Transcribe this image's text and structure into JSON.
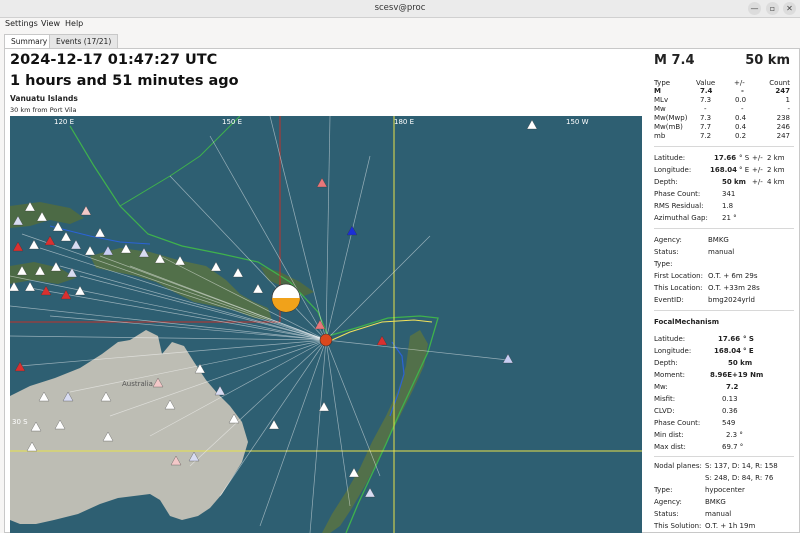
{
  "window": {
    "title": "scesv@proc",
    "controls": {
      "minimize": "—",
      "maximize": "▫",
      "close": "✕"
    }
  },
  "menu": [
    "Settings",
    "View",
    "Help"
  ],
  "tabs": [
    {
      "label": "Summary",
      "active": true
    },
    {
      "label": "Events (17/21)",
      "active": false
    }
  ],
  "header": {
    "datetime": "2024-12-17 01:47:27 UTC",
    "ago": "1 hours and 51 minutes ago",
    "region": "Vanuatu Islands",
    "nearby": "30 km from Port Vila"
  },
  "map": {
    "lon_labels": [
      "120 E",
      "150 E",
      "180 E",
      "150 W"
    ],
    "lat_labels": [
      "30 S"
    ],
    "place_labels": [
      "Australia"
    ],
    "colors": {
      "ocean": "#2e5f72",
      "land": "#b9b9b1",
      "grid": "#e8e24a",
      "region_box": "#c0302a",
      "ray": "#ffffff",
      "epicenter": "#d9481e"
    }
  },
  "summary": {
    "magnitude": "M 7.4",
    "depth": "50 km",
    "mag_table": {
      "headers": [
        "Type",
        "Value",
        "+/-",
        "Count"
      ],
      "rows": [
        [
          "M",
          "7.4",
          "-",
          "247"
        ],
        [
          "MLv",
          "7.3",
          "0.0",
          "1"
        ],
        [
          "Mw",
          "-",
          "-",
          "-"
        ],
        [
          "Mw(Mwp)",
          "7.3",
          "0.4",
          "238"
        ],
        [
          "Mw(mB)",
          "7.7",
          "0.4",
          "246"
        ],
        [
          "mb",
          "7.2",
          "0.2",
          "247"
        ]
      ]
    },
    "location": {
      "latitude_label": "Latitude:",
      "latitude": "17.66",
      "lat_unit": "° S",
      "lat_pm": "+/-",
      "lat_unc": "2 km",
      "longitude_label": "Longitude:",
      "longitude": "168.04",
      "lon_unit": "° E",
      "lon_pm": "+/-",
      "lon_unc": "2 km",
      "depth_label": "Depth:",
      "depth": "50",
      "depth_unit": "km",
      "depth_pm": "+/-",
      "depth_unc": "4 km",
      "phase_label": "Phase Count:",
      "phase_count": "341",
      "rms_label": "RMS Residual:",
      "rms": "1.8",
      "gap_label": "Azimuthal Gap:",
      "gap": "21 °"
    },
    "origin_info": {
      "agency_label": "Agency:",
      "agency": "BMKG",
      "status_label": "Status:",
      "status": "manual",
      "type_label": "Type:",
      "type": "",
      "first_label": "First Location:",
      "first_location": "O.T. + 6m 29s",
      "this_label": "This Location:",
      "this_location": "O.T. +33m 28s",
      "eventid_label": "EventID:",
      "event_id": "bmg2024yrld"
    },
    "focal": {
      "title": "FocalMechanism",
      "latitude_label": "Latitude:",
      "latitude": "17.66",
      "lat_unit": "° S",
      "longitude_label": "Longitude:",
      "longitude": "168.04",
      "lon_unit": "° E",
      "depth_label": "Depth:",
      "depth": "50 km",
      "moment_label": "Moment:",
      "moment": "8.96E+19 Nm",
      "mw_label": "Mw:",
      "mw": "7.2",
      "misfit_label": "Misfit:",
      "misfit": "0.13",
      "clvd_label": "CLVD:",
      "clvd": "0.36",
      "phase_label": "Phase Count:",
      "phase_count": "549",
      "mindist_label": "Min dist:",
      "min_dist": "2.3 °",
      "maxdist_label": "Max dist:",
      "max_dist": "69.7 °",
      "nodal_label": "Nodal planes:",
      "nodal1": "S: 137, D: 14, R: 158",
      "nodal2": "S: 248, D: 84, R: 76",
      "type_label": "Type:",
      "type": "hypocenter",
      "agency_label": "Agency:",
      "agency": "BMKG",
      "status_label": "Status:",
      "status": "manual",
      "solution_label": "This Solution:",
      "solution": "O.T. + 1h 19m"
    }
  }
}
